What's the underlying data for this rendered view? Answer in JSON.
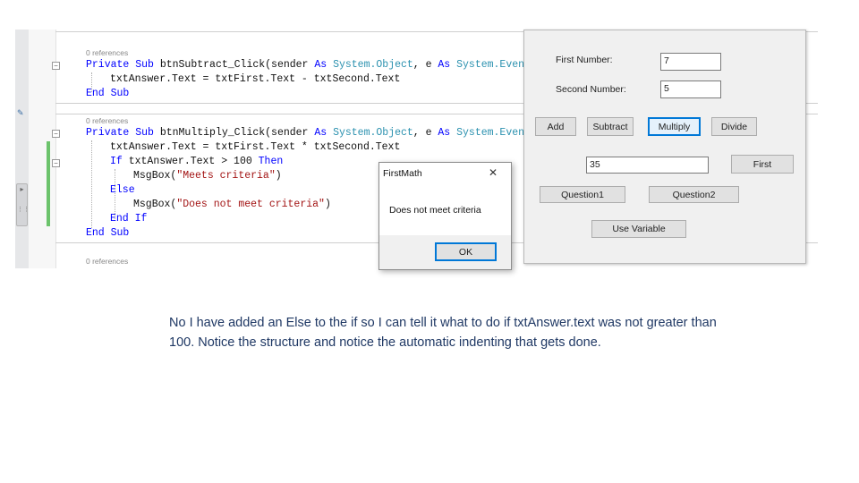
{
  "editor": {
    "refs1": "0 references",
    "refs2": "0 references",
    "refs3": "0 references",
    "line1": {
      "kw1": "Private Sub ",
      "name": "btnSubtract_Click(sender ",
      "as1": "As ",
      "t1": "System.Object",
      "mid": ", e ",
      "as2": "As ",
      "t2": "System.EventA"
    },
    "line2": "txtAnswer.Text = txtFirst.Text - txtSecond.Text",
    "line3": "End Sub",
    "line4": {
      "kw1": "Private Sub ",
      "name": "btnMultiply_Click(sender ",
      "as1": "As ",
      "t1": "System.Object",
      "mid": ", e ",
      "as2": "As ",
      "t2": "System.EventA"
    },
    "line5": "txtAnswer.Text = txtFirst.Text * txtSecond.Text",
    "line6": {
      "kw_if": "If ",
      "cond": "txtAnswer.Text > 100 ",
      "kw_then": "Then"
    },
    "line7": {
      "fn": "MsgBox(",
      "s": "\"Meets criteria\"",
      "end": ")"
    },
    "line8": "Else",
    "line9": {
      "fn": "MsgBox(",
      "s": "\"Does not meet criteria\"",
      "end": ")"
    },
    "line10": "End If",
    "line11": "End Sub"
  },
  "form": {
    "first_label": "First Number:",
    "first_value": "7",
    "second_label": "Second Number:",
    "second_value": "5",
    "btn_add": "Add",
    "btn_subtract": "Subtract",
    "btn_multiply": "Multiply",
    "btn_divide": "Divide",
    "answer_value": "35",
    "btn_first": "First",
    "btn_q1": "Question1",
    "btn_q2": "Question2",
    "btn_usevar": "Use Variable"
  },
  "msgbox": {
    "title": "FirstMath",
    "close": "✕",
    "message": "Does not meet criteria",
    "ok": "OK"
  },
  "caption": "No I have added an Else to the if so I can tell it what to do if txtAnswer.text was not greater than 100.  Notice the structure and notice the automatic indenting that gets done.",
  "colors": {
    "keyword": "#0000ff",
    "type": "#2b91af",
    "string": "#a31515",
    "caption": "#1f3864"
  }
}
